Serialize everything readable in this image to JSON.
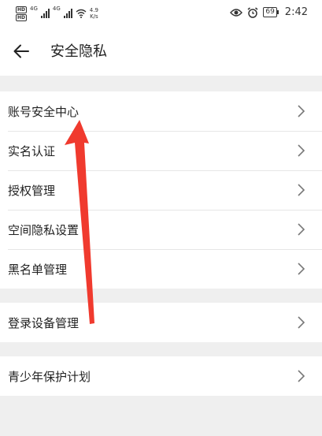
{
  "status_bar": {
    "net_1": "4G",
    "net_2": "4G",
    "speed_value": "4.9",
    "speed_unit": "K/s",
    "battery": "69",
    "time": "2:42"
  },
  "header": {
    "title": "安全隐私"
  },
  "groups": [
    {
      "items": [
        {
          "label": "账号安全中心"
        },
        {
          "label": "实名认证"
        },
        {
          "label": "授权管理"
        },
        {
          "label": "空间隐私设置"
        },
        {
          "label": "黑名单管理"
        }
      ]
    },
    {
      "items": [
        {
          "label": "登录设备管理"
        }
      ]
    },
    {
      "items": [
        {
          "label": "青少年保护计划"
        }
      ]
    }
  ],
  "colors": {
    "annotation_arrow": "#f03a2e",
    "background": "#efefef",
    "card": "#ffffff"
  }
}
